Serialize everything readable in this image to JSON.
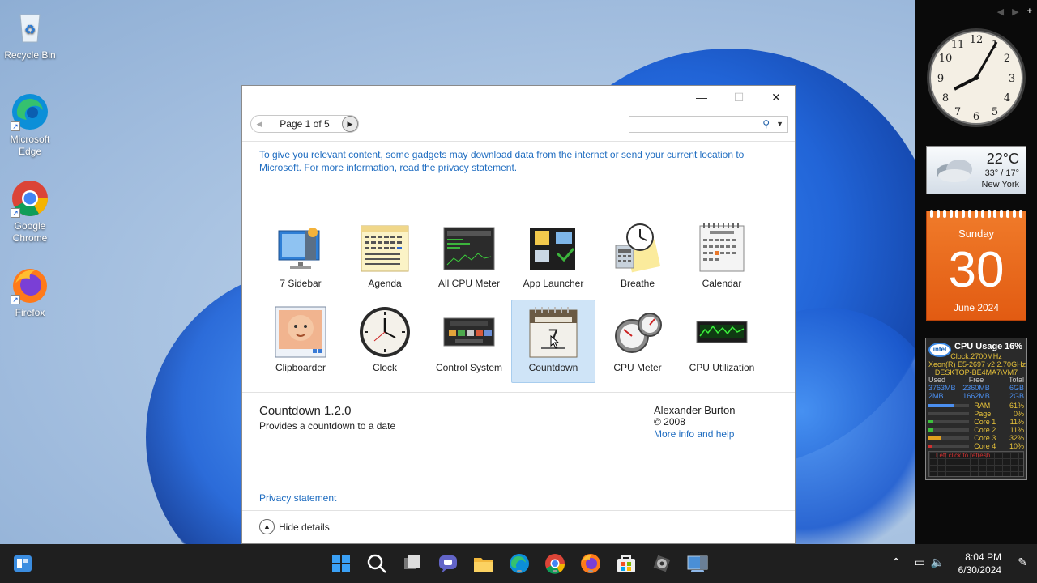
{
  "desktop": {
    "icons": [
      {
        "label": "Recycle Bin"
      },
      {
        "label": "Microsoft Edge"
      },
      {
        "label": "Google Chrome"
      },
      {
        "label": "Firefox"
      }
    ]
  },
  "dialog": {
    "pager_text": "Page 1 of 5",
    "search_placeholder": "",
    "notice": "To give you relevant content, some gadgets may download data from the internet or send your current location to Microsoft. For more information, read the privacy statement.",
    "gadgets": [
      {
        "name": "7 Sidebar",
        "icon": "sidebar-icon"
      },
      {
        "name": "Agenda",
        "icon": "agenda-icon"
      },
      {
        "name": "All CPU Meter",
        "icon": "cpu-meter-icon"
      },
      {
        "name": "App Launcher",
        "icon": "app-launcher-icon"
      },
      {
        "name": "Breathe",
        "icon": "breathe-icon"
      },
      {
        "name": "Calendar",
        "icon": "calendar-icon"
      },
      {
        "name": "Clipboarder",
        "icon": "clipboard-icon"
      },
      {
        "name": "Clock",
        "icon": "clock-icon"
      },
      {
        "name": "Control System",
        "icon": "control-system-icon"
      },
      {
        "name": "Countdown",
        "icon": "countdown-icon",
        "selected": true
      },
      {
        "name": "CPU Meter",
        "icon": "cpu-gauge-icon"
      },
      {
        "name": "CPU Utilization",
        "icon": "cpu-utilization-icon"
      }
    ],
    "details": {
      "title": "Countdown 1.2.0",
      "description": "Provides a countdown to a date",
      "author": "Alexander Burton",
      "copyright": "© 2008",
      "more_info": "More info and help"
    },
    "privacy_link": "Privacy statement",
    "hide_details": "Hide details"
  },
  "sidebar": {
    "weather": {
      "temp": "22°C",
      "range": "33° / 17°",
      "city": "New York"
    },
    "calendar": {
      "day": "Sunday",
      "date": "30",
      "month": "June 2024"
    },
    "cpu": {
      "title": "CPU Usage",
      "percent": "16%",
      "clock": "Clock:2700MHz",
      "model": "Xeon(R) E5-2697 v2 2.70GHz",
      "host": "DESKTOP-BE4MA7\\VM7",
      "mem_headers": [
        "Used",
        "Free",
        "Total"
      ],
      "mem_rows": [
        [
          "3763MB",
          "2360MB",
          "6GB"
        ],
        [
          "2MB",
          "1662MB",
          "2GB"
        ]
      ],
      "bars": [
        {
          "label": "RAM",
          "pct": "61%",
          "value": 0.61,
          "color": "#4b8ff0"
        },
        {
          "label": "Page",
          "pct": "0%",
          "value": 0.0,
          "color": "#4b8ff0"
        },
        {
          "label": "Core 1",
          "pct": "11%",
          "value": 0.11,
          "color": "#3cc03c"
        },
        {
          "label": "Core 2",
          "pct": "11%",
          "value": 0.11,
          "color": "#3cc03c"
        },
        {
          "label": "Core 3",
          "pct": "32%",
          "value": 0.32,
          "color": "#e0a020"
        },
        {
          "label": "Core 4",
          "pct": "10%",
          "value": 0.1,
          "color": "#d03030"
        }
      ],
      "graph_note": "Left click to refresh"
    }
  },
  "taskbar": {
    "time": "8:04 PM",
    "date": "6/30/2024"
  }
}
